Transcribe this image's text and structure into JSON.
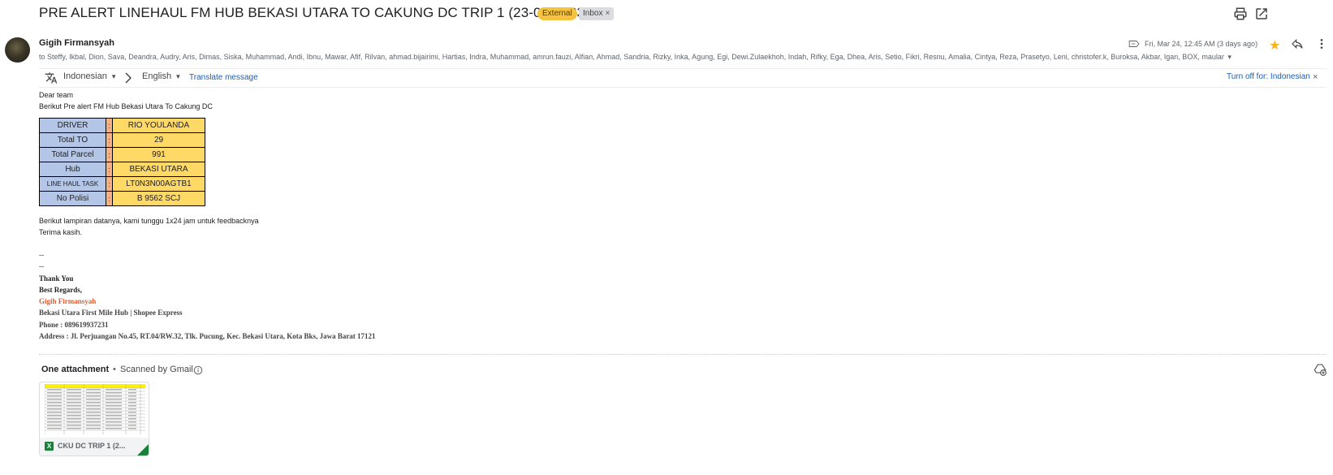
{
  "header": {
    "subject": "PRE ALERT LINEHAUL FM HUB BEKASI UTARA TO CAKUNG DC TRIP 1 (23-03-2023)",
    "badge_external": "External",
    "badge_inbox": "Inbox",
    "badge_inbox_close": "×"
  },
  "message": {
    "sender": "Gigih Firmansyah",
    "recipients": "to Steffy, Ikbal, Dion, Sava, Deandra, Audry, Aris, Dimas, Siska, Muhammad, Andi, Ibnu, Mawar, Afif, Rilvan, ahmad.bijairimi, Hartias, Indra, Muhammad, amrun.fauzi, Alfian, Ahmad, Sandria, Rizky, Inka, Agung, Egi, Dewi.Zulaekhoh, Indah, Rifky, Ega, Dhea, Aris, Setio, Fikri, Resnu, Amalia, Cintya, Reza, Prasetyo, Leni, christofer.k, Buroksa, Akbar, Igan, BOX, maular",
    "recipients_caret": "▾",
    "date": "Fri, Mar 24, 12:45 AM (3 days ago)",
    "star": "★"
  },
  "translate": {
    "from": "Indonesian",
    "to": "English",
    "caret": "▾",
    "link": "Translate message",
    "turn_off": "Turn off for: Indonesian",
    "close": "×"
  },
  "body": {
    "greeting": "Dear team",
    "intro": "Berikut Pre alert FM Hub Bekasi Utara To Cakung DC",
    "table": [
      {
        "key": "DRIVER",
        "sep": ":",
        "value": "RIO YOULANDA"
      },
      {
        "key": "Total TO",
        "sep": ":",
        "value": "29"
      },
      {
        "key": "Total Parcel",
        "sep": ":",
        "value": "991"
      },
      {
        "key": "Hub",
        "sep": ":",
        "value": "BEKASI UTARA"
      },
      {
        "key": "LINE HAUL TASK",
        "sep": ":",
        "value": "LT0N3N00AGTB1"
      },
      {
        "key": "No Polisi",
        "sep": ":",
        "value": "B 9562 SCJ"
      }
    ],
    "after_table": "Berikut lampiran datanya, kami tunggu 1x24 jam untuk feedbacknya",
    "thanks": "Terima kasih.",
    "dash1": "--",
    "dash2": "--"
  },
  "signature": {
    "thank_you": "Thank You",
    "regards": "Best Regards,",
    "name": "Gigih Firmansyah",
    "role": "Bekasi Utara First Mile Hub |  Shopee Express",
    "phone": "Phone : 089619937231",
    "address": "Address : Jl. Perjuangan No.45, RT.04/RW.32, Tlk. Pucung, Kec. Bekasi Utara, Kota Bks, Jawa Barat 17121"
  },
  "attachments": {
    "title": "One attachment",
    "separator": "•",
    "scanned": "Scanned by Gmail",
    "file_name": "CKU DC TRIP 1 (2...",
    "file_type_letter": "X"
  },
  "colors": {
    "table_key_bg": "#b4c6e7",
    "table_sep_bg": "#f4b183",
    "table_value_bg": "#ffd966",
    "external_badge": "#f5c242",
    "link": "#1a5fb4",
    "signature_name": "#e8572a",
    "star": "#f6b41a"
  },
  "icons": [
    "print-icon",
    "open-in-new-window-icon",
    "label-icon",
    "star-icon",
    "reply-icon",
    "more-vert-icon",
    "translate-icon",
    "chevron-right-icon",
    "info-icon",
    "add-to-drive-icon",
    "excel-file-icon"
  ]
}
